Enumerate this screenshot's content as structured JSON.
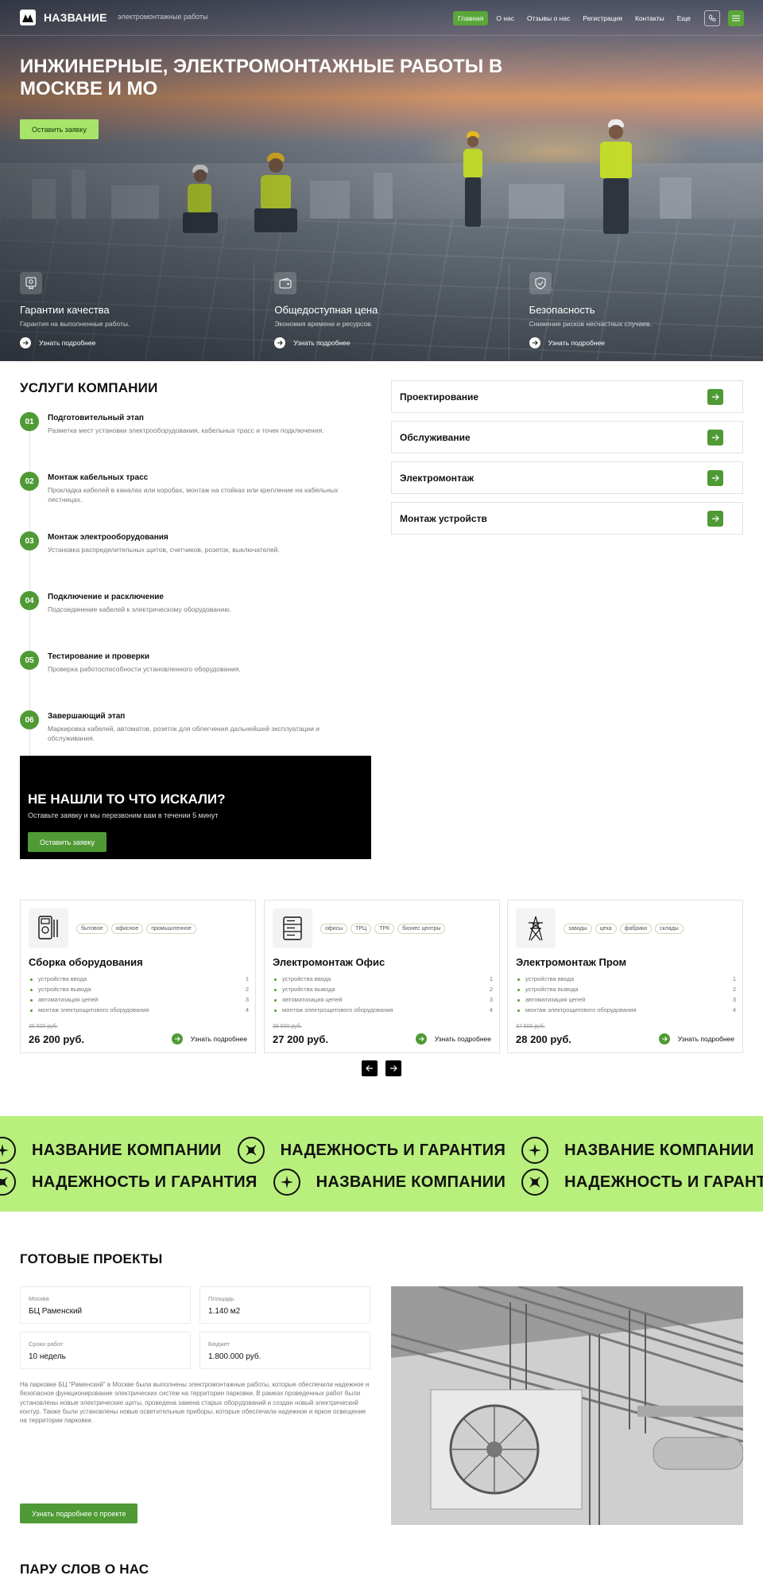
{
  "header": {
    "logo_text": "НАЗВАНИЕ",
    "tagline": "электромонтажные работы",
    "nav": [
      "Главная",
      "О нас",
      "Отзывы о нас",
      "Регистрация",
      "Контакты",
      "Еще"
    ],
    "active_nav_index": 0,
    "accent_color": "#5aa63a"
  },
  "hero": {
    "title": "ИНЖИНЕРНЫЕ, ЭЛЕКТРОМОНТАЖНЫЕ РАБОТЫ В МОСКВЕ И МО",
    "cta": "Оставить заявку",
    "features": [
      {
        "icon": "certificate-icon",
        "title": "Гарантии качества",
        "subtitle": "Гарантия на выполненные работы.",
        "link": "Узнать подробнее"
      },
      {
        "icon": "wallet-icon",
        "title": "Общедоступная цена",
        "subtitle": "Экономия времени и ресурсов.",
        "link": "Узнать подробнее"
      },
      {
        "icon": "shield-check-icon",
        "title": "Безопасность",
        "subtitle": "Снижение рисков несчастных случаев.",
        "link": "Узнать подробнее"
      }
    ]
  },
  "services": {
    "title": "УСЛУГИ КОМПАНИИ",
    "steps": [
      {
        "num": "01",
        "title": "Подготовительный этап",
        "desc": "Разметка мест установки электрооборудования, кабельных трасс и точек подключения."
      },
      {
        "num": "02",
        "title": "Монтаж кабельных трасс",
        "desc": "Прокладка кабелей в каналах или коробах, монтаж на стойках или крепление на кабельных лестницах."
      },
      {
        "num": "03",
        "title": "Монтаж электрооборудования",
        "desc": "Установка распределительных щитов, счетчиков, розеток, выключателей."
      },
      {
        "num": "04",
        "title": "Подключение и расключение",
        "desc": "Подсоединение кабелей к электрическому оборудованию."
      },
      {
        "num": "05",
        "title": "Тестирование и проверки",
        "desc": "Проверка работоспособности установленного оборудования."
      },
      {
        "num": "06",
        "title": "Завершающий этап",
        "desc": "Маркировка кабелей, автоматов, розеток для облегчения дальнейшей эксплуатации и обслуживания."
      }
    ],
    "list": [
      "Проектирование",
      "Обслуживание",
      "Электромонтаж",
      "Монтаж устройств"
    ]
  },
  "callout": {
    "title": "НЕ НАШЛИ ТО ЧТО ИСКАЛИ?",
    "subtitle": "Оставьте заявку и мы перезвоним вам в течении 5 минут",
    "button": "Оставить заявку"
  },
  "cards": [
    {
      "icon": "multimeter-icon",
      "tags": [
        "бытовое",
        "офисное",
        "промышленное"
      ],
      "title": "Сборка оборудования",
      "features": [
        "устройства ввода",
        "устройства вывода",
        "автоматизация цепей",
        "монтаж электрощитового оборудования"
      ],
      "nums": [
        "1",
        "2",
        "3",
        "4"
      ],
      "old_price": "35 500 руб.",
      "price": "26 200 руб.",
      "more": "Узнать подробнее"
    },
    {
      "icon": "server-rack-icon",
      "tags": [
        "офисы",
        "ТРЦ",
        "ТРК",
        "бизнес центры"
      ],
      "title": "Электромонтаж Офис",
      "features": [
        "устройства ввода",
        "устройства вывода",
        "автоматизация цепей",
        "монтаж электрощитового оборудования"
      ],
      "nums": [
        "1",
        "2",
        "3",
        "4"
      ],
      "old_price": "38 500 руб.",
      "price": "27 200 руб.",
      "more": "Узнать подробнее"
    },
    {
      "icon": "power-tower-icon",
      "tags": [
        "заводы",
        "цеха",
        "фабрики",
        "склады"
      ],
      "title": "Электромонтаж Пром",
      "features": [
        "устройства ввода",
        "устройства вывода",
        "автоматизация цепей",
        "монтаж электрощитового оборудования"
      ],
      "nums": [
        "1",
        "2",
        "3",
        "4"
      ],
      "old_price": "37 600 руб.",
      "price": "28 200 руб.",
      "more": "Узнать подробнее"
    }
  ],
  "marquee": {
    "phrase_a": "НАЗВАНИЕ КОМПАНИИ",
    "phrase_b": "НАДЕЖНОСТЬ И ГАРАНТИЯ",
    "background": "#b9ef7d"
  },
  "projects": {
    "title": "ГОТОВЫЕ ПРОЕКТЫ",
    "city_label": "Москва",
    "city_value": "БЦ Раменский",
    "area_label": "Площадь",
    "area_value": "1.140 м2",
    "term_label": "Сроки работ",
    "term_value": "10 недель",
    "budget_label": "Бюджет",
    "budget_value": "1.800.000 руб.",
    "description": "На парковке БЦ \"Раменский\" в Москве были выполнены электромонтажные работы, которые обеспечили надежное и безопасное функционирование электрических систем на территории парковки. В рамках проведенных работ были установлены новые электрические щиты, проведена замена старых оборудований и создан новый электрический контур. Также были установлены новые осветительные приборы, которые обеспечили надежное и яркое освещение на территории парковки.",
    "button": "Узнать подробнее о проекте"
  },
  "about": {
    "title": "ПАРУ СЛОВ О НАС"
  }
}
